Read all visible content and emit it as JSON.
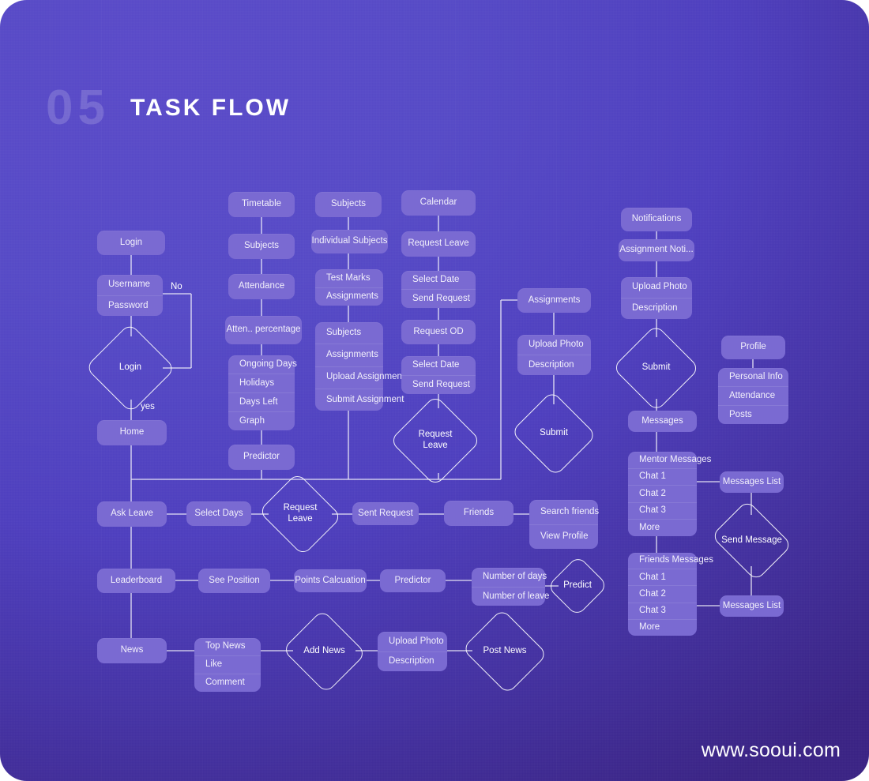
{
  "header": {
    "number": "05",
    "title": "TASK FLOW"
  },
  "footer": {
    "url": "www.sooui.com"
  },
  "theme": {
    "background_start": "#5a4ac8",
    "background_end": "#3a2384",
    "node_fill": "#7a6ad2",
    "line_color": "#ffffff",
    "text_color": "#f2f0fb"
  },
  "edge_labels": {
    "no": "No",
    "yes": "yes"
  },
  "nodes": {
    "login": "Login",
    "username": "Username",
    "password": "Password",
    "login_decision": "Login",
    "home": "Home",
    "timetable": "Timetable",
    "subjects_tt": "Subjects",
    "attendance": "Attendance",
    "atten_percentage": "Atten.. percentage",
    "ongoing_days": "Ongoing Days",
    "holidays": "Holidays",
    "days_left": "Days Left",
    "graph": "Graph",
    "predictor_top": "Predictor",
    "subjects_col": "Subjects",
    "individual_subjects": "Individual Subjects",
    "test_marks": "Test Marks",
    "assignments_small": "Assignments",
    "subjects_list": "Subjects",
    "assignments_list": "Assignments",
    "upload_assignment": "Upload Assignment",
    "submit_assignment": "Submit Assignment",
    "calendar": "Calendar",
    "request_leave_box": "Request Leave",
    "select_date_1": "Select Date",
    "send_request_1": "Send Request",
    "request_od": "Request OD",
    "select_date_2": "Select Date",
    "send_request_2": "Send Request",
    "request_leave_diamond": "Request\nLeave",
    "assignments": "Assignments",
    "upload_photo_a": "Upload Photo",
    "description_a": "Description",
    "submit_a": "Submit",
    "notifications": "Notifications",
    "assignment_noti": "Assignment Noti...",
    "upload_photo_n": "Upload Photo",
    "description_n": "Description",
    "submit_n": "Submit",
    "messages": "Messages",
    "mentor_messages": "Mentor Messages",
    "mentor_chat_1": "Chat 1",
    "mentor_chat_2": "Chat 2",
    "mentor_chat_3": "Chat 3",
    "mentor_more": "More",
    "friends_messages": "Friends Messages",
    "friend_chat_1": "Chat 1",
    "friend_chat_2": "Chat 2",
    "friend_chat_3": "Chat 3",
    "friend_more": "More",
    "messages_list_top": "Messages List",
    "send_message": "Send Message",
    "messages_list_bottom": "Messages List",
    "profile": "Profile",
    "personal_info": "Personal Info",
    "profile_attendance": "Attendance",
    "posts": "Posts",
    "ask_leave": "Ask Leave",
    "select_days": "Select Days",
    "request_leave_diamond_2": "Request\nLeave",
    "sent_request": "Sent Request",
    "friends": "Friends",
    "search_friends": "Search friends",
    "view_profile": "View Profile",
    "leaderboard": "Leaderboard",
    "see_position": "See Position",
    "points_calcuation": "Points Calcuation",
    "predictor": "Predictor",
    "number_of_days": "Number of days",
    "number_of_leave": "Number of leave",
    "predict": "Predict",
    "news": "News",
    "top_news": "Top News",
    "like": "Like",
    "comment": "Comment",
    "add_news": "Add News",
    "upload_photo_news": "Upload Photo",
    "description_news": "Description",
    "post_news": "Post News"
  }
}
